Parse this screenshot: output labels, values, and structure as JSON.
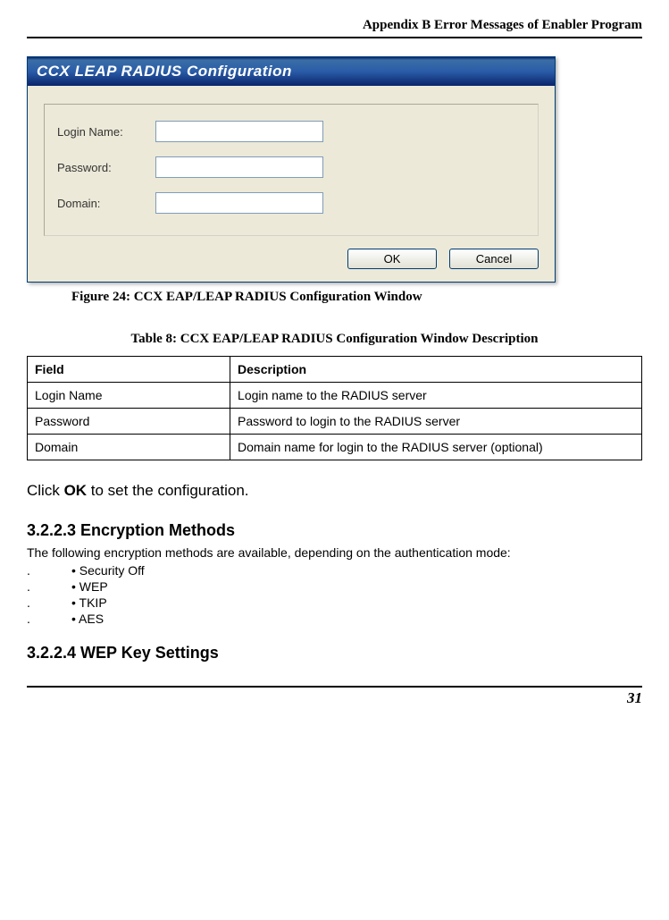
{
  "header": "Appendix B Error Messages of Enabler Program",
  "dialog": {
    "title": "CCX LEAP RADIUS Configuration",
    "fields": {
      "login_label": "Login Name:",
      "login_value": "",
      "password_label": "Password:",
      "password_value": "",
      "domain_label": "Domain:",
      "domain_value": ""
    },
    "ok_label": "OK",
    "cancel_label": "Cancel"
  },
  "figure": {
    "prefix": "Figure 24: ",
    "title": "CCX EAP/LEAP RADIUS Configuration Window"
  },
  "table_caption": "Table 8: CCX EAP/LEAP RADIUS Configuration Window Description",
  "table": {
    "head_field": "Field",
    "head_desc": "Description",
    "rows": [
      {
        "field": "Login Name",
        "desc": "Login name to the RADIUS server"
      },
      {
        "field": "Password",
        "desc": "Password to login to the RADIUS server"
      },
      {
        "field": "Domain",
        "desc": "Domain name for login to the RADIUS server (optional)"
      }
    ]
  },
  "instruction_pre": "Click ",
  "instruction_bold": "OK",
  "instruction_post": " to set the configuration.",
  "section1": {
    "head": "3.2.2.3 Encryption Methods",
    "intro": "The following encryption methods are available, depending on the authentication mode:",
    "bullets": [
      "• Security Off",
      "• WEP",
      "• TKIP",
      "• AES"
    ]
  },
  "section2": {
    "head": "3.2.2.4 WEP Key Settings"
  },
  "page_number": "31"
}
